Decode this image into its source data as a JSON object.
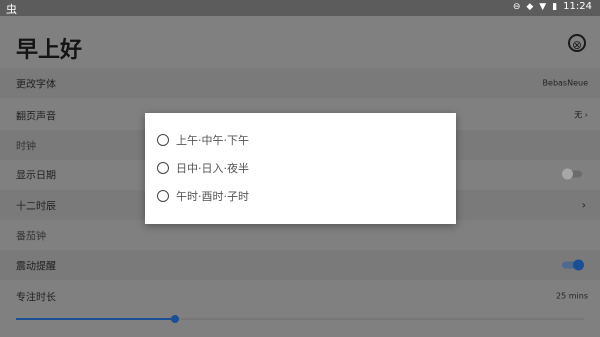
{
  "status_bar": {
    "left_icon": "虫",
    "time": "11:24",
    "icons": [
      "minus-circle-icon",
      "diamond-icon",
      "wifi-icon",
      "battery-icon"
    ]
  },
  "header": {
    "title": "早上好",
    "close_icon": "⊗"
  },
  "settings": {
    "font": {
      "label": "更改字体",
      "value": "BebasNeue"
    },
    "page_sound": {
      "label": "翻页声音",
      "value": "无"
    },
    "clock_section": {
      "label": "时钟"
    },
    "show_date": {
      "label": "显示日期",
      "enabled": false
    },
    "twelve_hours": {
      "label": "十二时辰"
    },
    "tomato_section": {
      "label": "番茄钟"
    },
    "vibrate": {
      "label": "震动提醒",
      "enabled": true
    },
    "focus_duration": {
      "label": "专注时长",
      "value": "25 mins",
      "level_fraction": 0.28
    }
  },
  "dialog": {
    "options": [
      {
        "label": "上午·中午·下午",
        "selected": false
      },
      {
        "label": "日中·日入·夜半",
        "selected": false
      },
      {
        "label": "午时·酉时·子时",
        "selected": false
      }
    ]
  },
  "colors": {
    "accent": "#1b4f93",
    "scrim_background": "#808080",
    "dialog_background": "#ffffff"
  }
}
